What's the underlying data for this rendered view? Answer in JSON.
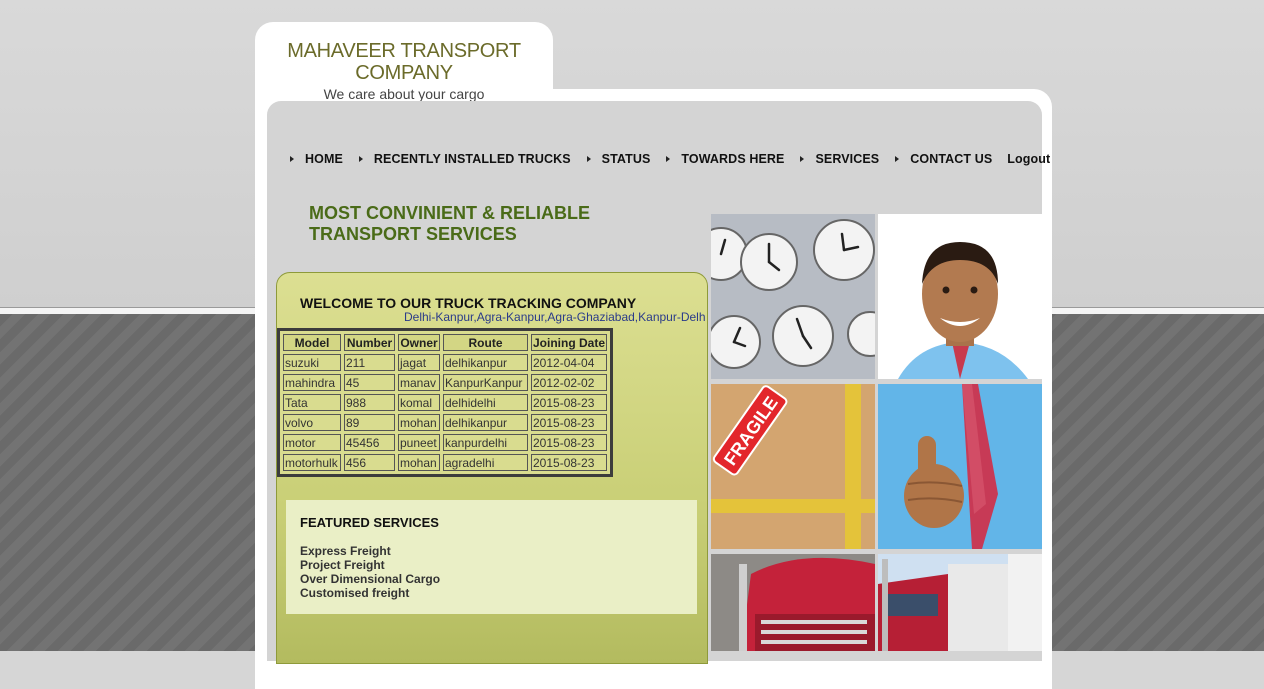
{
  "brand": {
    "title": "MAHAVEER TRANSPORT COMPANY",
    "tagline": "We care about your cargo"
  },
  "nav": {
    "items": [
      {
        "label": "HOME"
      },
      {
        "label": "RECENTLY INSTALLED TRUCKS"
      },
      {
        "label": "STATUS"
      },
      {
        "label": "TOWARDS HERE"
      },
      {
        "label": "SERVICES"
      },
      {
        "label": "CONTACT US"
      }
    ],
    "logout": "Logout"
  },
  "headline": "MOST CONVINIENT & RELIABLE TRANSPORT SERVICES",
  "welcome": {
    "title": "WELCOME TO OUR TRUCK TRACKING COMPANY",
    "routes": "Delhi-Kanpur,Agra-Kanpur,Agra-Ghaziabad,Kanpur-Delhi"
  },
  "trucks": {
    "headers": [
      "Model",
      "Number",
      "Owner",
      "Route",
      "Joining Date"
    ],
    "rows": [
      [
        "suzuki",
        "211",
        "jagat",
        "delhikanpur",
        "2012-04-04"
      ],
      [
        "mahindra",
        "45",
        "manav",
        "KanpurKanpur",
        "2012-02-02"
      ],
      [
        "Tata",
        "988",
        "komal",
        "delhidelhi",
        "2015-08-23"
      ],
      [
        "volvo",
        "89",
        "mohan",
        "delhikanpur",
        "2015-08-23"
      ],
      [
        "motor",
        "45456",
        "puneet",
        "kanpurdelhi",
        "2015-08-23"
      ],
      [
        "motorhulk",
        "456",
        "mohan",
        "agradelhi",
        "2015-08-23"
      ]
    ]
  },
  "featured": {
    "title": "FEATURED SERVICES",
    "items": [
      "Express Freight",
      "Project Freight",
      "Over Dimensional Cargo",
      "Customised freight"
    ]
  },
  "photos": {
    "fragile_label": "FRAGILE"
  },
  "colors": {
    "headline": "#4a6b18",
    "routes_link": "#2b3b8a",
    "welcome_bg": "#d4d884",
    "featured_bg": "#eaefc6"
  }
}
